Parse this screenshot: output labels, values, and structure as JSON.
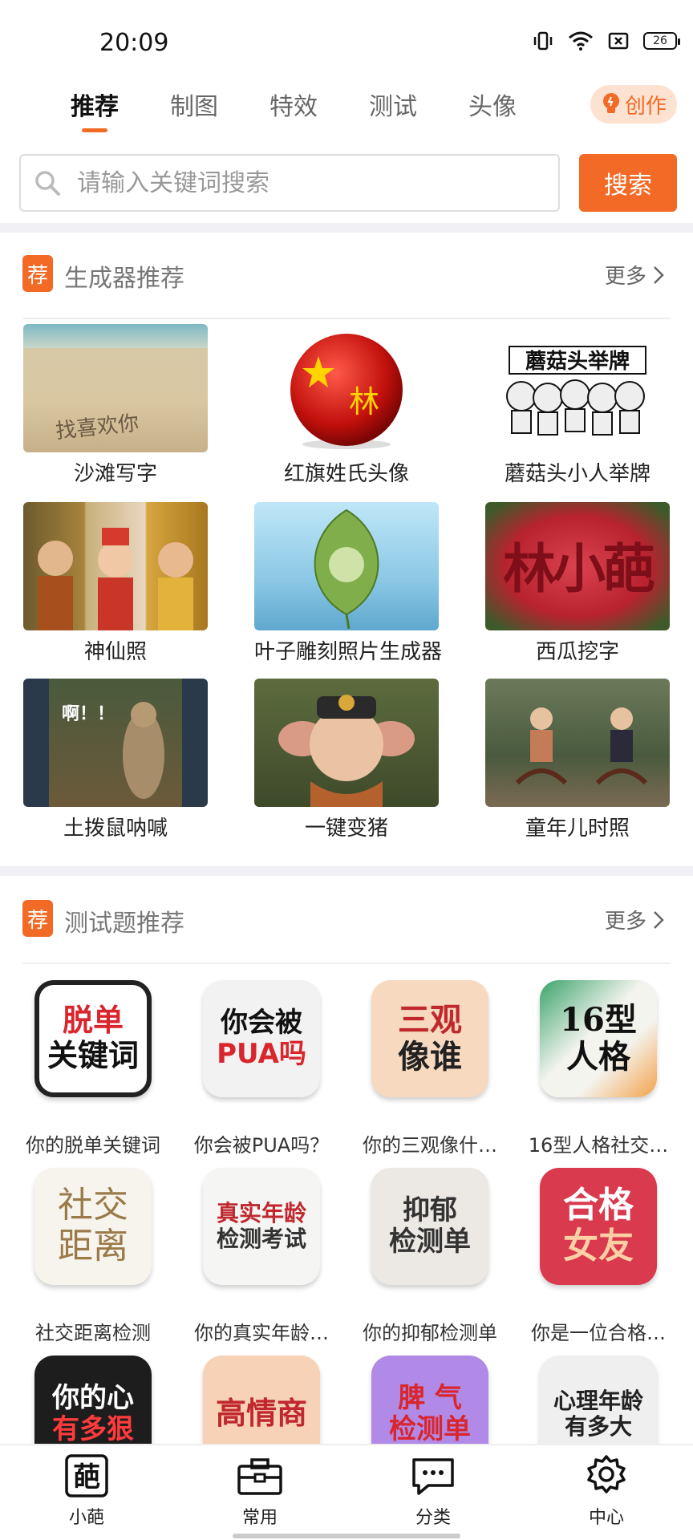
{
  "status": {
    "time": "20:09",
    "battery": "26"
  },
  "tabs": [
    {
      "label": "推荐",
      "active": true
    },
    {
      "label": "制图",
      "active": false
    },
    {
      "label": "特效",
      "active": false
    },
    {
      "label": "测试",
      "active": false
    },
    {
      "label": "头像",
      "active": false
    }
  ],
  "create_label": "创作",
  "search": {
    "placeholder": "请输入关键词搜索",
    "button": "搜索"
  },
  "generators": {
    "badge": "荐",
    "title": "生成器推荐",
    "more": "更多",
    "items": [
      {
        "label": "沙滩写字",
        "art": "找喜欢你"
      },
      {
        "label": "红旗姓氏头像",
        "art": "林"
      },
      {
        "label": "蘑菇头小人举牌",
        "art": "蘑菇头举牌"
      },
      {
        "label": "神仙照"
      },
      {
        "label": "叶子雕刻照片生成器"
      },
      {
        "label": "西瓜挖字",
        "art": "林小葩"
      },
      {
        "label": "土拨鼠呐喊",
        "art": "啊！！"
      },
      {
        "label": "一键变猪"
      },
      {
        "label": "童年儿时照"
      }
    ]
  },
  "quizzes": {
    "badge": "荐",
    "title": "测试题推荐",
    "more": "更多",
    "items": [
      {
        "label": "你的脱单关键词",
        "line1": "脱单",
        "line2": "关键词"
      },
      {
        "label": "你会被PUA吗？",
        "line1": "你会被",
        "line2": "PUA吗"
      },
      {
        "label": "你的三观像什…",
        "line1": "三观",
        "line2": "像谁"
      },
      {
        "label": "16型人格社交…",
        "line1": "16型",
        "line2": "人格"
      },
      {
        "label": "社交距离检测",
        "line1": "社交",
        "line2": "距离"
      },
      {
        "label": "你的真实年龄…",
        "line1": "真实年龄",
        "line2": "检测考试"
      },
      {
        "label": "你的抑郁检测单",
        "line1": "抑郁",
        "line2": "检测单"
      },
      {
        "label": "你是一位合格…",
        "line1": "合格",
        "line2": "女友"
      },
      {
        "label": "",
        "line1": "你的心",
        "line2": "有多狠"
      },
      {
        "label": "",
        "line1": "高情商",
        "line2": ""
      },
      {
        "label": "",
        "line1": "脾 气",
        "line2": "检测单"
      },
      {
        "label": "",
        "line1": "心理年龄",
        "line2": "有多大"
      }
    ]
  },
  "bottom_nav": [
    {
      "label": "小葩",
      "icon": "葩"
    },
    {
      "label": "常用"
    },
    {
      "label": "分类"
    },
    {
      "label": "中心"
    }
  ]
}
